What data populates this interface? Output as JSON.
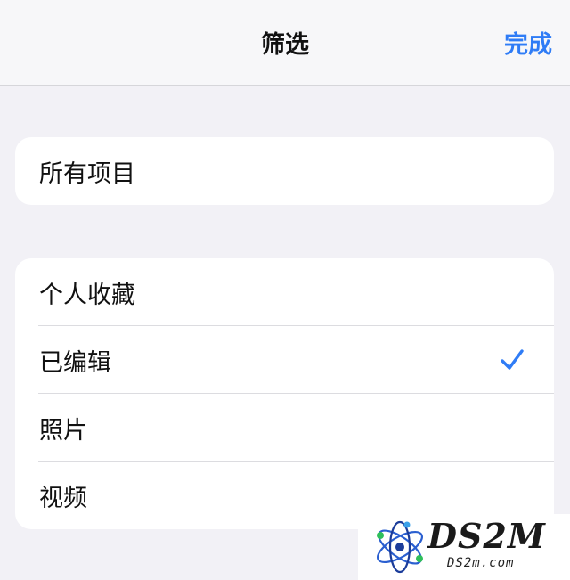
{
  "navbar": {
    "title": "筛选",
    "done_label": "完成"
  },
  "groups": [
    {
      "rows": [
        {
          "label": "所有项目",
          "selected": false
        }
      ]
    },
    {
      "rows": [
        {
          "label": "个人收藏",
          "selected": false
        },
        {
          "label": "已编辑",
          "selected": true
        },
        {
          "label": "照片",
          "selected": false
        },
        {
          "label": "视频",
          "selected": false
        }
      ]
    }
  ],
  "icons": {
    "check": "checkmark-icon"
  },
  "colors": {
    "accent": "#2f7cf6",
    "background": "#f2f1f6",
    "cell": "#ffffff"
  },
  "watermark": {
    "brand": "DS2M",
    "domain": "DS2m.com"
  }
}
